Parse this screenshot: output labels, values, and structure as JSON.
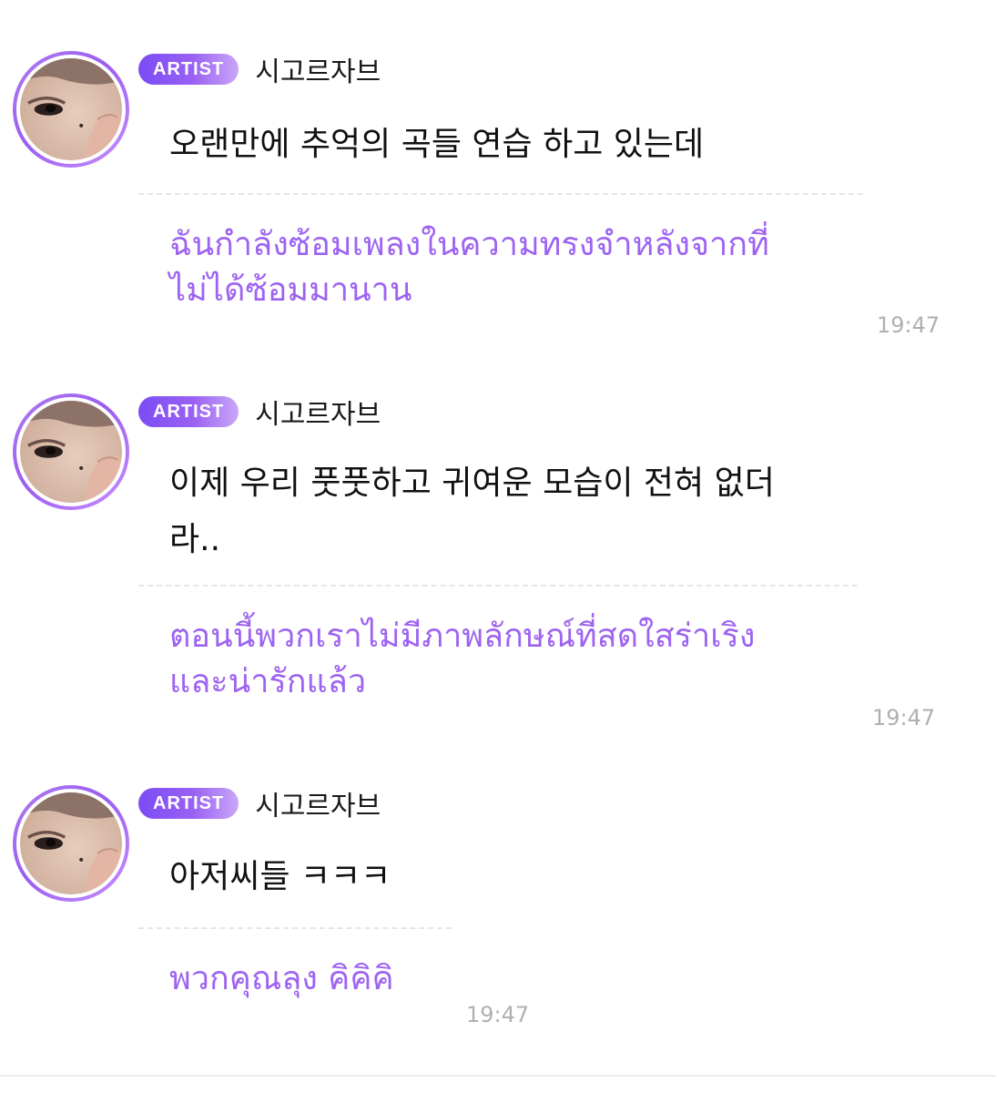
{
  "colors": {
    "badge_gradient_start": "#7b4cf5",
    "badge_gradient_end": "#caa6f8",
    "translation_purple": "#9d63f2",
    "avatar_ring": "#a86ef2",
    "timestamp_gray": "#b0b0b0"
  },
  "messages": [
    {
      "avatar_icon": "artist-profile-photo",
      "badge": "ARTIST",
      "username": "시고르자브",
      "original": "오랜만에 추억의 곡들 연습 하고 있는데",
      "translation": "ฉันกำลังซ้อมเพลงในความทรงจำหลังจากที่\nไม่ได้ซ้อมมานาน",
      "time": "19:47"
    },
    {
      "avatar_icon": "artist-profile-photo",
      "badge": "ARTIST",
      "username": "시고르자브",
      "original": "이제 우리 풋풋하고 귀여운 모습이 전혀 없더\n라..",
      "translation": "ตอนนี้พวกเราไม่มีภาพลักษณ์ที่สดใสร่าเริง\nและน่ารักแล้ว",
      "time": "19:47"
    },
    {
      "avatar_icon": "artist-profile-photo",
      "badge": "ARTIST",
      "username": "시고르자브",
      "original": "아저씨들 ㅋㅋㅋ",
      "translation": "พวกคุณลุง คิคิคิ",
      "time": "19:47"
    }
  ]
}
